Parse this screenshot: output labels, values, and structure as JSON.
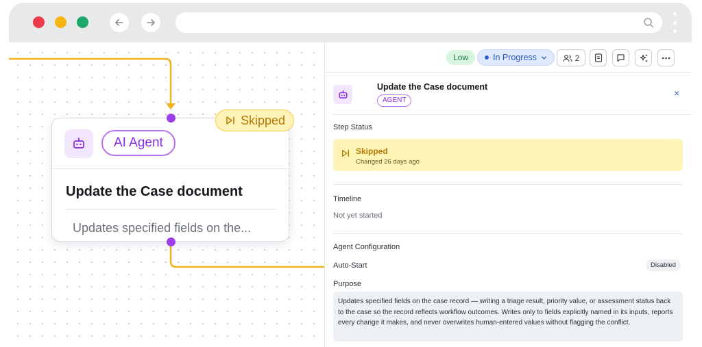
{
  "colors": {
    "accent_purple": "#8a2be2",
    "connector_yellow": "#efb11c",
    "skipped_bg": "#fdf4b6",
    "status_blue": "#2455b9",
    "low_green": "#1f7a3d"
  },
  "browser": {
    "back_icon": "arrow-left-icon",
    "forward_icon": "arrow-right-icon",
    "search_icon": "search-icon",
    "url": ""
  },
  "node": {
    "tag": "AI Agent",
    "title": "Update the Case document",
    "description": "Updates specified fields on the...",
    "status_badge": "Skipped",
    "icon": "robot-icon"
  },
  "panel": {
    "priority": "Low",
    "status": "In Progress",
    "assignee_count": "2",
    "title": "Update the Case document",
    "tag": "AGENT",
    "close": "×",
    "step_status_label": "Step Status",
    "step_status_value": "Skipped",
    "step_status_changed": "Changed 26 days ago",
    "timeline_label": "Timeline",
    "timeline_value": "Not yet started",
    "agent_config_label": "Agent Configuration",
    "auto_start_label": "Auto-Start",
    "auto_start_value": "Disabled",
    "purpose_label": "Purpose",
    "purpose_text": "Updates specified fields on the case record — writing a triage result, priority value, or assessment status back to the case so the record reflects workflow outcomes. Writes only to fields explicitly named in its inputs, reports every change it makes, and never overwrites human-entered values without flagging the conflict."
  }
}
